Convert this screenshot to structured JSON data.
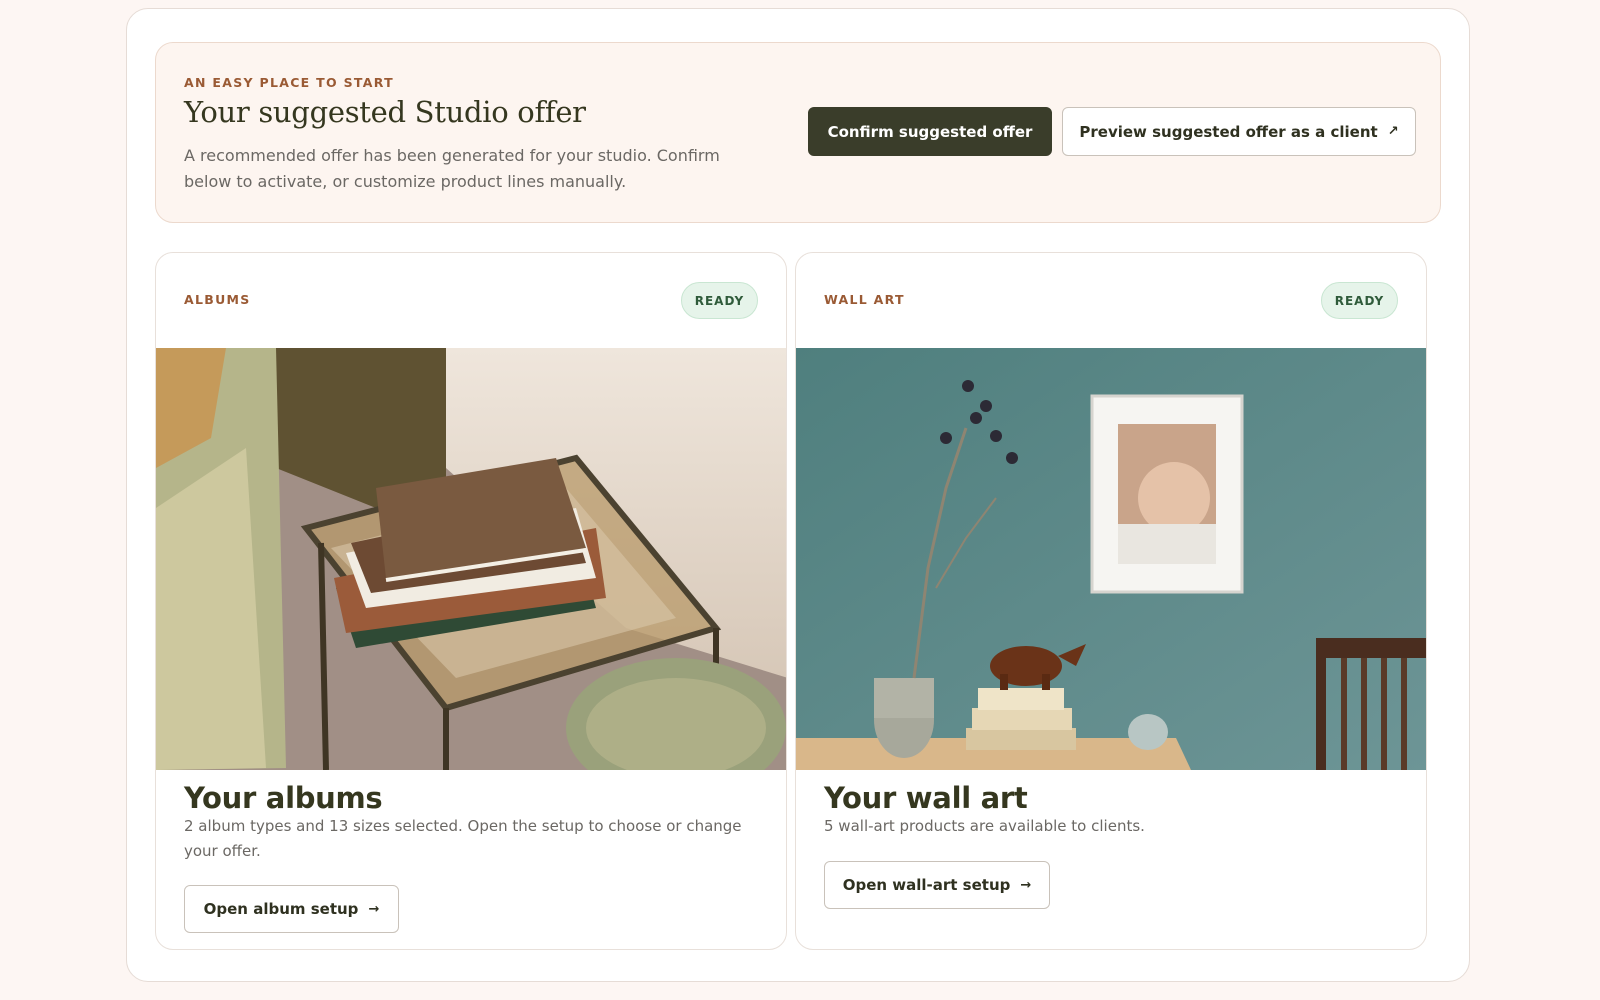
{
  "hero": {
    "eyebrow": "AN EASY PLACE TO START",
    "title": "Your suggested Studio offer",
    "description": "A recommended offer has been generated for your studio. Confirm below to activate, or customize product lines manually.",
    "confirm_label": "Confirm suggested offer",
    "preview_label": "Preview suggested offer as a client",
    "preview_icon": "external-arrow-icon"
  },
  "cards": [
    {
      "eyebrow": "ALBUMS",
      "badge": "READY",
      "title": "Your albums",
      "description": "2 album types and 13 sizes selected. Open the setup to choose or change your offer.",
      "button_label": "Open album setup",
      "button_icon": "arrow-right-icon"
    },
    {
      "eyebrow": "WALL ART",
      "badge": "READY",
      "title": "Your wall art",
      "description": "5 wall-art products are available to clients.",
      "button_label": "Open wall-art setup",
      "button_icon": "arrow-right-icon"
    }
  ],
  "colors": {
    "accent_eyebrow": "#9a5a34",
    "primary_button": "#3a3d2a",
    "badge_bg": "#e6f4ea",
    "badge_text": "#2f5b3a",
    "page_bg": "#fdf6f3"
  }
}
